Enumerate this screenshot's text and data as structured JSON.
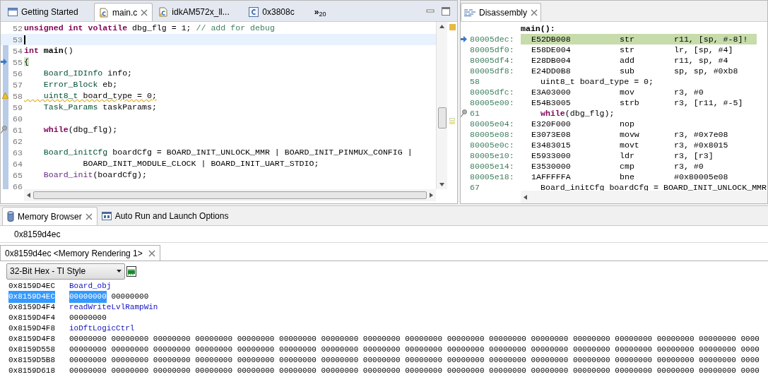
{
  "editor": {
    "tabs": [
      {
        "label": "Getting Started",
        "kind": "welcome",
        "selected": false,
        "closable": false
      },
      {
        "label": "main.c",
        "kind": "source",
        "selected": true,
        "closable": true
      },
      {
        "label": "idkAM572x_ll...",
        "kind": "source",
        "selected": false,
        "closable": false
      },
      {
        "label": "0x3808c",
        "kind": "address",
        "selected": false,
        "closable": false
      }
    ],
    "overflow": {
      "symbol": "»",
      "count": "20"
    },
    "lines": [
      {
        "number": "52",
        "kind": "plain",
        "current": false,
        "tokens": [
          {
            "text": "unsigned int volatile",
            "kind": "kw"
          },
          {
            "text": " dbg_flg = 1; ",
            "kind": "plain"
          },
          {
            "text": "// add for debug",
            "kind": "comment"
          }
        ]
      },
      {
        "number": "53",
        "kind": "plain",
        "current": true
      },
      {
        "number": "54",
        "kind": "plain",
        "current": false,
        "tokens": [
          {
            "text": "int ",
            "kind": "kw"
          },
          {
            "text": "main",
            "kind": "bold"
          },
          {
            "text": "()",
            "kind": "plain"
          }
        ]
      },
      {
        "number": "55",
        "kind": "pointer",
        "current": false,
        "tokens": [
          {
            "text": "{",
            "kind": "brace"
          }
        ]
      },
      {
        "number": "56",
        "kind": "plain",
        "current": false,
        "tokens": [
          {
            "text": "    Board_IDInfo",
            "kind": "type"
          },
          {
            "text": " info;",
            "kind": "plain"
          }
        ]
      },
      {
        "number": "57",
        "kind": "plain",
        "current": false,
        "tokens": [
          {
            "text": "    Error_Block",
            "kind": "type"
          },
          {
            "text": " eb;",
            "kind": "plain"
          }
        ]
      },
      {
        "number": "58",
        "kind": "warning",
        "current": false,
        "tokens": [
          {
            "text": "    uint8_t",
            "kind": "type"
          },
          {
            "text": " board_type = 0;",
            "kind": "plain"
          }
        ]
      },
      {
        "number": "59",
        "kind": "plain",
        "current": false,
        "tokens": [
          {
            "text": "    Task_Params",
            "kind": "type"
          },
          {
            "text": " taskParams;",
            "kind": "plain"
          }
        ]
      },
      {
        "number": "60",
        "kind": "plain",
        "current": false
      },
      {
        "number": "61",
        "kind": "pinned",
        "current": false,
        "tokens": [
          {
            "text": "    while",
            "kind": "kw"
          },
          {
            "text": "(dbg_flg);",
            "kind": "plain"
          }
        ]
      },
      {
        "number": "62",
        "kind": "plain",
        "current": false
      },
      {
        "number": "63",
        "kind": "plain",
        "current": false,
        "tokens": [
          {
            "text": "    Board_initCfg",
            "kind": "type"
          },
          {
            "text": " boardCfg = BOARD_INIT_UNLOCK_MMR | BOARD_INIT_PINMUX_CONFIG |",
            "kind": "plain"
          }
        ]
      },
      {
        "number": "64",
        "kind": "plain",
        "current": false,
        "tokens": [
          {
            "text": "            BOARD_INIT_MODULE_CLOCK | BOARD_INIT_UART_STDIO;",
            "kind": "plain"
          }
        ]
      },
      {
        "number": "65",
        "kind": "plain",
        "current": false,
        "tokens": [
          {
            "text": "    Board_init",
            "kind": "fn"
          },
          {
            "text": "(boardCfg);",
            "kind": "plain"
          }
        ]
      },
      {
        "number": "66",
        "kind": "plain",
        "current": false
      }
    ]
  },
  "disassembly": {
    "tab": {
      "label": "Disassembly",
      "selected": true
    },
    "rows": [
      {
        "kind": "label",
        "text": "main():"
      },
      {
        "kind": "instr",
        "current": true,
        "address": "80005dec:",
        "opcode": "E52DB008",
        "mnemonic": "str",
        "operands": "r11, [sp, #-8]!"
      },
      {
        "kind": "instr",
        "current": false,
        "address": "80005df0:",
        "opcode": "E58DE004",
        "mnemonic": "str",
        "operands": "lr, [sp, #4]"
      },
      {
        "kind": "instr",
        "current": false,
        "address": "80005df4:",
        "opcode": "E28DB004",
        "mnemonic": "add",
        "operands": "r11, sp, #4"
      },
      {
        "kind": "instr",
        "current": false,
        "address": "80005df8:",
        "opcode": "E24DD0B8",
        "mnemonic": "sub",
        "operands": "sp, sp, #0xb8"
      },
      {
        "kind": "source",
        "pinned": false,
        "number": "58",
        "tokens": [
          {
            "text": "uint8_t board_type = 0;",
            "kind": "plain"
          }
        ]
      },
      {
        "kind": "instr",
        "current": false,
        "address": "80005dfc:",
        "opcode": "E3A03000",
        "mnemonic": "mov",
        "operands": "r3, #0"
      },
      {
        "kind": "instr",
        "current": false,
        "address": "80005e00:",
        "opcode": "E54B3005",
        "mnemonic": "strb",
        "operands": "r3, [r11, #-5]"
      },
      {
        "kind": "source",
        "pinned": true,
        "number": "61",
        "tokens": [
          {
            "text": "while",
            "kind": "kw"
          },
          {
            "text": "(dbg_flg);",
            "kind": "plain"
          }
        ]
      },
      {
        "kind": "instr",
        "current": false,
        "address": "80005e04:",
        "opcode": "E320F000",
        "mnemonic": "nop"
      },
      {
        "kind": "instr",
        "current": false,
        "address": "80005e08:",
        "opcode": "E3073E08",
        "mnemonic": "movw",
        "operands": "r3, #0x7e08"
      },
      {
        "kind": "instr",
        "current": false,
        "address": "80005e0c:",
        "opcode": "E3483015",
        "mnemonic": "movt",
        "operands": "r3, #0x8015"
      },
      {
        "kind": "instr",
        "current": false,
        "address": "80005e10:",
        "opcode": "E5933000",
        "mnemonic": "ldr",
        "operands": "r3, [r3]"
      },
      {
        "kind": "instr",
        "current": false,
        "address": "80005e14:",
        "opcode": "E3530000",
        "mnemonic": "cmp",
        "operands": "r3, #0"
      },
      {
        "kind": "instr",
        "current": false,
        "address": "80005e18:",
        "opcode": "1AFFFFFA",
        "mnemonic": "bne",
        "operands": "#0x80005e08"
      },
      {
        "kind": "source",
        "pinned": false,
        "number": "67",
        "tokens": [
          {
            "text": "Board_initCfg boardCfg = BOARD_INIT_UNLOCK_MMR",
            "kind": "plain"
          }
        ]
      }
    ]
  },
  "bottom_tabs": [
    {
      "label": "Memory Browser",
      "kind": "memory",
      "selected": true,
      "closable": true
    },
    {
      "label": "Auto Run and Launch Options",
      "kind": "options",
      "selected": false,
      "closable": false
    }
  ],
  "memory": {
    "address_field": "0x8159d4ec",
    "rendering_tab": {
      "label": "0x8159d4ec <Memory Rendering 1>",
      "selected": true
    },
    "format": "32-Bit Hex - TI Style",
    "rows": [
      {
        "kind": "label",
        "address": "0x8159D4EC",
        "symbol": "Board_obj",
        "selected": false
      },
      {
        "kind": "data",
        "address": "0x8159D4EC",
        "selected": true,
        "words": [
          "00000000",
          "00000000"
        ]
      },
      {
        "kind": "label",
        "address": "0x8159D4F4",
        "symbol": "readWriteLvlRampWin",
        "selected": false
      },
      {
        "kind": "data",
        "address": "0x8159D4F4",
        "selected": false,
        "words": [
          "00000000"
        ]
      },
      {
        "kind": "label",
        "address": "0x8159D4F8",
        "symbol": "ioDftLogicCtrl",
        "selected": false
      },
      {
        "kind": "data",
        "address": "0x8159D4F8",
        "selected": false,
        "words": [
          "00000000",
          "00000000",
          "00000000",
          "00000000",
          "00000000",
          "00000000",
          "00000000",
          "00000000",
          "00000000",
          "00000000",
          "00000000",
          "00000000",
          "00000000",
          "00000000",
          "00000000",
          "00000000",
          "0000"
        ]
      },
      {
        "kind": "data",
        "address": "0x8159D558",
        "selected": false,
        "words": [
          "00000000",
          "00000000",
          "00000000",
          "00000000",
          "00000000",
          "00000000",
          "00000000",
          "00000000",
          "00000000",
          "00000000",
          "00000000",
          "00000000",
          "00000000",
          "00000000",
          "00000000",
          "00000000",
          "0000"
        ]
      },
      {
        "kind": "data",
        "address": "0x8159D5B8",
        "selected": false,
        "words": [
          "00000000",
          "00000000",
          "00000000",
          "00000000",
          "00000000",
          "00000000",
          "00000000",
          "00000000",
          "00000000",
          "00000000",
          "00000000",
          "00000000",
          "00000000",
          "00000000",
          "00000000",
          "00000000",
          "0000"
        ]
      },
      {
        "kind": "data",
        "address": "0x8159D618",
        "selected": false,
        "words": [
          "00000000",
          "00000000",
          "00000000",
          "00000000",
          "00000000",
          "00000000",
          "00000000",
          "00000000",
          "00000000",
          "00000000",
          "00000000",
          "00000000",
          "00000000",
          "00000000",
          "00000000",
          "00000000",
          "0000"
        ]
      }
    ]
  }
}
